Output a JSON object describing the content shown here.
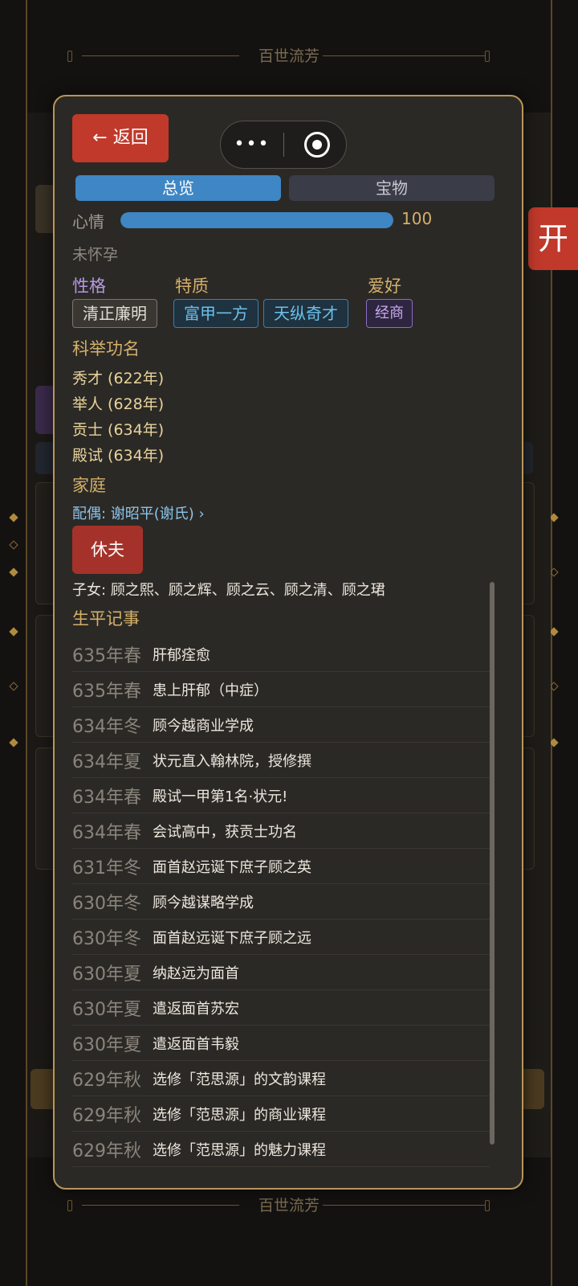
{
  "page": {
    "decor_title": "百世流芳",
    "open_tab_label": "开"
  },
  "modal": {
    "back_label": "← 返回",
    "more_glyph": "•••",
    "tabs": [
      {
        "label": "总览",
        "active": true
      },
      {
        "label": "宝物",
        "active": false
      }
    ],
    "mood": {
      "label": "心情",
      "value": 100,
      "max": 100,
      "fraction": 1.0
    },
    "pregnancy": "未怀孕",
    "personality": {
      "title": "性格",
      "tags": [
        "清正廉明"
      ]
    },
    "traits": {
      "title": "特质",
      "tags": [
        "富甲一方",
        "天纵奇才"
      ]
    },
    "hobby": {
      "title": "爱好",
      "tags": [
        "经商"
      ]
    },
    "exam": {
      "title": "科举功名",
      "items": [
        "秀才 (622年)",
        "举人 (628年)",
        "贡士 (634年)",
        "殿试 (634年)"
      ]
    },
    "family": {
      "title": "家庭",
      "spouse": "配偶: 谢昭平(谢氏) ›",
      "divorce_label": "休夫",
      "children": "子女: 顾之熙、顾之辉、顾之云、顾之清、顾之珺"
    },
    "chronicle": {
      "title": "生平记事",
      "events": [
        {
          "when": "635年春",
          "what": "肝郁痊愈"
        },
        {
          "when": "635年春",
          "what": "患上肝郁（中症）"
        },
        {
          "when": "634年冬",
          "what": "顾今越商业学成"
        },
        {
          "when": "634年夏",
          "what": "状元直入翰林院，授修撰"
        },
        {
          "when": "634年春",
          "what": "殿试一甲第1名·状元!"
        },
        {
          "when": "634年春",
          "what": "会试高中，获贡士功名"
        },
        {
          "when": "631年冬",
          "what": "面首赵远诞下庶子顾之英"
        },
        {
          "when": "630年冬",
          "what": "顾今越谋略学成"
        },
        {
          "when": "630年冬",
          "what": "面首赵远诞下庶子顾之远"
        },
        {
          "when": "630年夏",
          "what": "纳赵远为面首"
        },
        {
          "when": "630年夏",
          "what": "遣返面首苏宏"
        },
        {
          "when": "630年夏",
          "what": "遣返面首韦毅"
        },
        {
          "when": "629年秋",
          "what": "选修「范思源」的文韵课程"
        },
        {
          "when": "629年秋",
          "what": "选修「范思源」的商业课程"
        },
        {
          "when": "629年秋",
          "what": "选修「范思源」的魅力课程"
        }
      ]
    }
  }
}
